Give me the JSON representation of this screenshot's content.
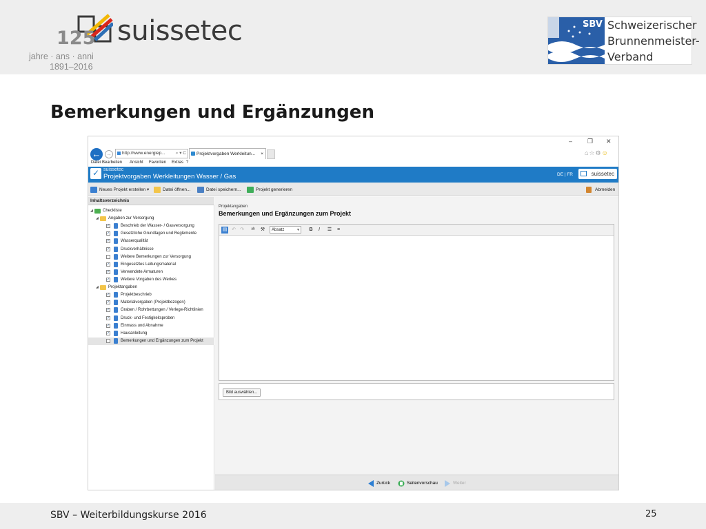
{
  "header": {
    "logo_125": "125",
    "logo_word": "suissetec",
    "logo_sub1": "jahre · ans · anni",
    "logo_sub2": "1891–2016",
    "sbv_abbr": "SBV",
    "sbv_line1": "Schweizerischer",
    "sbv_line2": "Brunnenmeister-",
    "sbv_line3": "Verband"
  },
  "slide": {
    "title": "Bemerkungen und Ergänzungen"
  },
  "browser": {
    "address": "http://www.energiep...",
    "address_icons": "⌕ ▾ C",
    "tab_label": "Projektvorgaben Werkleitun...",
    "tab_close": "×",
    "menu": [
      "Datei",
      "Bearbeiten",
      "Ansicht",
      "Favoriten",
      "Extras",
      "?"
    ]
  },
  "app": {
    "name": "suissetec",
    "title": "Projektvorgaben Werkleitungen Wasser / Gas",
    "lang": "DE | FR",
    "badge": "suissetec"
  },
  "toolbar": {
    "new_project": "Neues Projekt erstellen ▾",
    "open_file": "Datei öffnen...",
    "save_file": "Datei speichern...",
    "generate": "Projekt generieren",
    "logout": "Abmelden"
  },
  "sidebar": {
    "title": "Inhaltsverzeichnis",
    "root": "Checkliste",
    "group1": "Angaben zur Versorgung",
    "group1_items": [
      {
        "label": "Beschrieb der Wasser- / Gasversorgung",
        "checked": true
      },
      {
        "label": "Gesetzliche Grundlagen und Reglemente",
        "checked": true
      },
      {
        "label": "Wasserqualität",
        "checked": true
      },
      {
        "label": "Druckverhältnisse",
        "checked": true
      },
      {
        "label": "Weitere Bemerkungen zur Versorgung",
        "checked": false
      },
      {
        "label": "Eingesetztes Leitungsmaterial",
        "checked": true
      },
      {
        "label": "Verwendete Armaturen",
        "checked": true
      },
      {
        "label": "Weitere Vorgaben des Werkes",
        "checked": true
      }
    ],
    "group2": "Projektangaben",
    "group2_items": [
      {
        "label": "Projektbeschrieb",
        "checked": true
      },
      {
        "label": "Materialvorgaben (Projektbezogen)",
        "checked": true
      },
      {
        "label": "Graben / Rohrbettungen / Verlege-Richtlinien",
        "checked": true
      },
      {
        "label": "Druck- und Festigkeitsproben",
        "checked": true
      },
      {
        "label": "Einmass und Abnahme",
        "checked": true
      },
      {
        "label": "Hausanleitung",
        "checked": true
      },
      {
        "label": "Bemerkungen und Ergänzungen zum Projekt",
        "checked": false
      }
    ]
  },
  "content": {
    "section": "Projektangaben",
    "title": "Bemerkungen und Ergänzungen zum Projekt",
    "format_select": "Absatz",
    "image_button": "Bild auswählen..."
  },
  "footer_nav": {
    "back": "Zurück",
    "preview": "Seitenvorschau",
    "next": "Weiter"
  },
  "footer": {
    "left": "SBV – Weiterbildungskurse 2016",
    "page": "25"
  },
  "colors": {
    "app_blue": "#1f7bc6",
    "header_gray": "#eeeeee"
  }
}
